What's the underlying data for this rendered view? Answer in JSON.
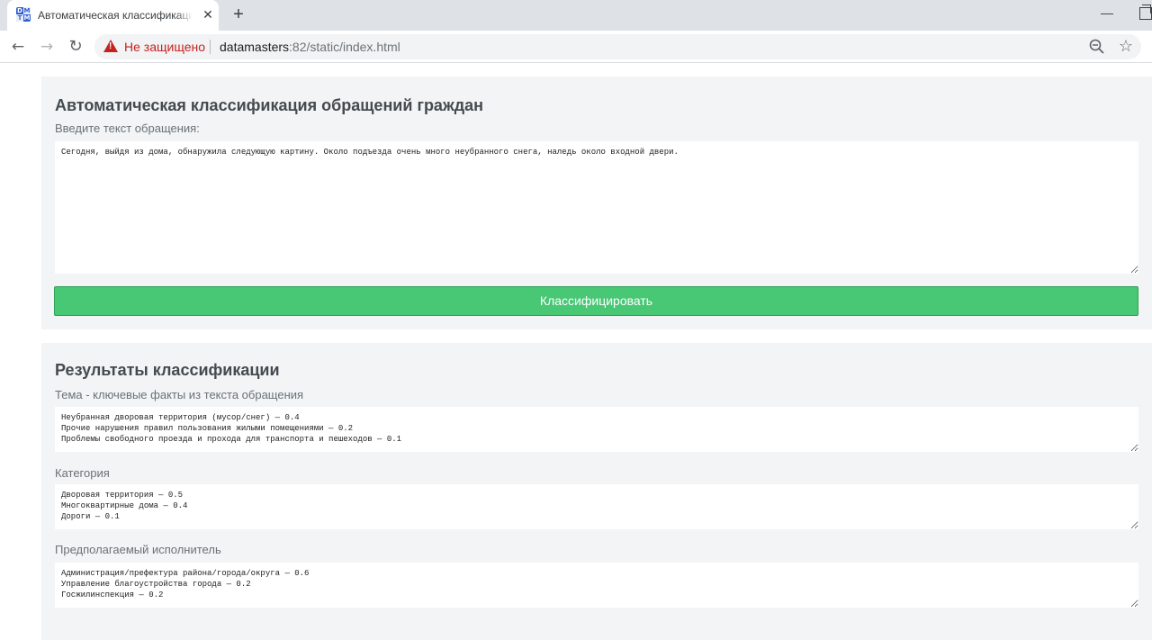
{
  "browser": {
    "tab_title": "Автоматическая классификаци",
    "tab_close": "✕",
    "new_tab": "+",
    "minimize": "—",
    "favicon_letters": [
      "D",
      "M",
      "T",
      "M"
    ],
    "security_label": "Не защищено",
    "url_host": "datamasters",
    "url_rest": ":82/static/index.html",
    "back": "←",
    "forward": "→",
    "reload": "↻",
    "star": "☆"
  },
  "form": {
    "title": "Автоматическая классификация обращений граждан",
    "prompt_label": "Введите текст обращения:",
    "input_value": "Сегодня, выйдя из дома, обнаружила следующую картину. Около подъезда очень много неубранного снега, наледь около входной двери.",
    "classify_button": "Классифицировать"
  },
  "results": {
    "title": "Результаты классификации",
    "topic_label": "Тема - ключевые факты из текста обращения",
    "topic_value": "Неубранная дворовая территория (мусор/снег) — 0.4\nПрочие нарушения правил пользования жилыми помещениями — 0.2\nПроблемы свободного проезда и прохода для транспорта и пешеходов — 0.1",
    "category_label": "Категория",
    "category_value": "Дворовая территория — 0.5\nМногоквартирные дома — 0.4\nДороги — 0.1",
    "executor_label": "Предполагаемый исполнитель",
    "executor_value": "Администрация/префектура района/города/округа — 0.6\nУправление благоустройства города — 0.2\nГосжилинспекция — 0.2"
  }
}
